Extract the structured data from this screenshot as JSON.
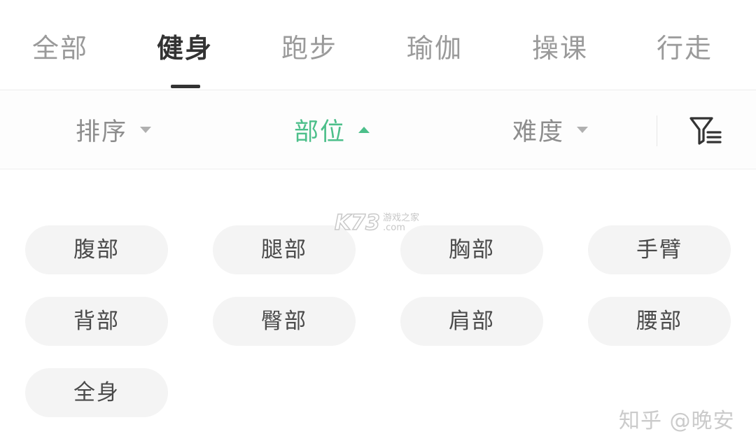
{
  "tabs": [
    {
      "label": "全部",
      "active": false
    },
    {
      "label": "健身",
      "active": true
    },
    {
      "label": "跑步",
      "active": false
    },
    {
      "label": "瑜伽",
      "active": false
    },
    {
      "label": "操课",
      "active": false
    },
    {
      "label": "行走",
      "active": false
    }
  ],
  "filters": {
    "sort": {
      "label": "排序",
      "state": "collapsed"
    },
    "body_part": {
      "label": "部位",
      "state": "expanded"
    },
    "difficulty": {
      "label": "难度",
      "state": "collapsed"
    },
    "more_filter_icon": "filter-list-icon"
  },
  "body_parts": [
    "腹部",
    "腿部",
    "胸部",
    "手臂",
    "背部",
    "臀部",
    "肩部",
    "腰部",
    "全身"
  ],
  "watermarks": {
    "k73_logo": "K73",
    "k73_line1": "游戏之家",
    "k73_line2": ".com",
    "zhihu": "知乎 @晚安"
  },
  "colors": {
    "accent": "#4cbf8a",
    "active_tab": "#333333",
    "inactive_text": "#9a9a9a",
    "chip_bg": "#f4f4f4"
  }
}
